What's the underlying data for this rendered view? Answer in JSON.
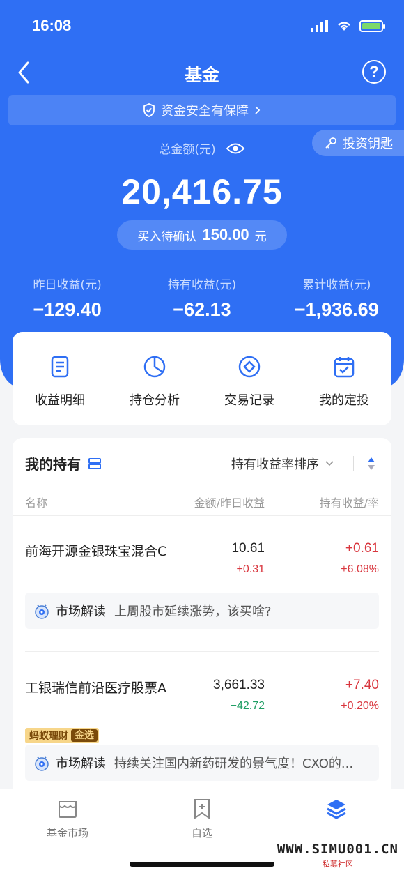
{
  "status": {
    "time": "16:08"
  },
  "nav": {
    "title": "基金"
  },
  "safety": {
    "text": "资金安全有保障"
  },
  "key_pill": {
    "label": "投资钥匙"
  },
  "total": {
    "label": "总金额(元)",
    "value": "20,416.75"
  },
  "pending": {
    "label": "买入待确认",
    "amount": "150.00",
    "unit": "元"
  },
  "stats": [
    {
      "label": "昨日收益(元)",
      "value": "−129.40"
    },
    {
      "label": "持有收益(元)",
      "value": "−62.13"
    },
    {
      "label": "累计收益(元)",
      "value": "−1,936.69"
    }
  ],
  "quick": [
    {
      "label": "收益明细",
      "icon": "document-icon"
    },
    {
      "label": "持仓分析",
      "icon": "pie-chart-icon"
    },
    {
      "label": "交易记录",
      "icon": "record-icon"
    },
    {
      "label": "我的定投",
      "icon": "calendar-check-icon"
    }
  ],
  "holdings": {
    "title": "我的持有",
    "sort_label": "持有收益率排序",
    "columns": {
      "name": "名称",
      "amount": "金额/昨日收益",
      "profit": "持有收益/率"
    },
    "funds": [
      {
        "name": "前海开源金银珠宝混合C",
        "amount": "10.61",
        "day": "+0.31",
        "profit": "+0.61",
        "rate": "+6.08%",
        "market_label": "市场解读",
        "market_text": "上周股市延续涨势，该买啥?"
      },
      {
        "name": "工银瑞信前沿医疗股票A",
        "amount": "3,661.33",
        "day": "−42.72",
        "profit": "+7.40",
        "rate": "+0.20%",
        "badge_left": "蚂蚁理财",
        "badge_right": "金选",
        "market_label": "市场解读",
        "market_text": "持续关注国内新药研发的景气度！CXO的..."
      }
    ]
  },
  "tabs": [
    {
      "label": "基金市场"
    },
    {
      "label": "自选"
    }
  ],
  "watermark": {
    "line1": "WWW.SIMU001.CN",
    "line2": "私募社区"
  }
}
